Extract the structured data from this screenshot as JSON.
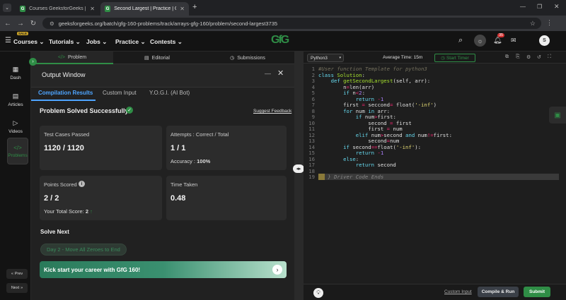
{
  "browser": {
    "tabs": [
      {
        "title": "Courses GeeksforGeeks | Intera",
        "active": false
      },
      {
        "title": "Second Largest | Practice | Gee",
        "active": true
      }
    ],
    "url": "geeksforgeeks.org/batch/gfg-160-problems/track/arrays-gfg-160/problem/second-largest3735",
    "notification_count": "35",
    "profile_initial": "S"
  },
  "site_nav": {
    "items": [
      "Courses",
      "Tutorials",
      "Jobs",
      "Practice",
      "Contests"
    ],
    "sale_badge": "SALE",
    "logo": "GfG"
  },
  "rail": {
    "items": [
      {
        "label": "Dash",
        "icon": "grid-icon"
      },
      {
        "label": "Articles",
        "icon": "article-icon"
      },
      {
        "label": "Videos",
        "icon": "video-icon"
      },
      {
        "label": "Problems",
        "icon": "code-icon",
        "active": true
      }
    ],
    "prev_label": "Prev",
    "next_label": "Next"
  },
  "left_tabs": [
    {
      "label": "Problem",
      "icon": "</>"
    },
    {
      "label": "Editorial",
      "icon": "▤"
    },
    {
      "label": "Submissions",
      "icon": "◷"
    }
  ],
  "output": {
    "title": "Output Window",
    "tabs": [
      "Compilation Results",
      "Custom Input",
      "Y.O.G.I. (AI Bot)"
    ],
    "status": "Problem Solved Successfully",
    "feedback": "Suggest Feedback",
    "test_cases_label": "Test Cases Passed",
    "test_cases_value": "1120 / 1120",
    "attempts_label": "Attempts : Correct / Total",
    "attempts_value": "1 / 1",
    "accuracy_label": "Accuracy :",
    "accuracy_value": "100%",
    "points_label": "Points Scored",
    "points_value": "2 / 2",
    "total_score_label": "Your Total Score:",
    "total_score_value": "2",
    "time_label": "Time Taken",
    "time_value": "0.48",
    "solve_next_label": "Solve Next",
    "next_problem": "Day 2 - Move All Zeroes to End",
    "banner": "Kick start your career with GfG 160!"
  },
  "editor": {
    "language": "Python3",
    "avg_time": "Average Time: 15m",
    "timer_label": "Start Timer",
    "custom_input": "Custom Input",
    "compile_label": "Compile & Run",
    "submit_label": "Submit",
    "driver_code": "} Driver Code Ends",
    "colors": {
      "accent": "#2f8d46"
    }
  }
}
